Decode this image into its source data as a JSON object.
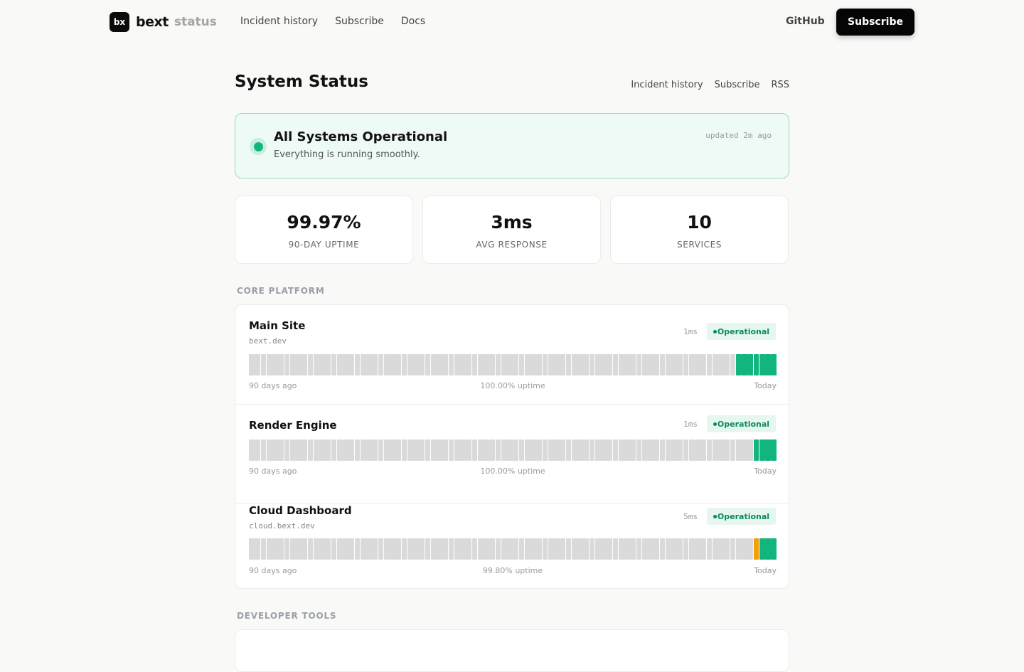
{
  "brand": {
    "mark": "bx",
    "name": "bext",
    "sub": "status"
  },
  "nav": {
    "links": [
      "Incident history",
      "Subscribe",
      "Docs"
    ],
    "github": "GitHub",
    "subscribe": "Subscribe"
  },
  "page": {
    "title": "System Status",
    "links": [
      "Incident history",
      "Subscribe",
      "RSS"
    ]
  },
  "status": {
    "title": "All Systems Operational",
    "subtitle": "Everything is running smoothly.",
    "updated": "updated 2m ago",
    "color": "#12b57e"
  },
  "stats": [
    {
      "value": "99.97%",
      "label": "90-DAY UPTIME"
    },
    {
      "value": "3ms",
      "label": "AVG RESPONSE"
    },
    {
      "value": "10",
      "label": "SERVICES"
    }
  ],
  "sections": [
    {
      "label": "CORE PLATFORM",
      "services": [
        {
          "name": "Main Site",
          "domain": "bext.dev",
          "latency": "1ms",
          "status": "Operational",
          "uptime_days": {
            "total": 90,
            "up_recent": 7,
            "warn_recent": 0
          },
          "foot": {
            "left": "90 days ago",
            "center": "100.00% uptime",
            "right": "Today"
          }
        },
        {
          "name": "Render Engine",
          "domain": "",
          "latency": "1ms",
          "status": "Operational",
          "uptime_days": {
            "total": 90,
            "up_recent": 4,
            "warn_recent": 0
          },
          "foot": {
            "left": "90 days ago",
            "center": "100.00% uptime",
            "right": "Today"
          }
        },
        {
          "name": "Cloud Dashboard",
          "domain": "cloud.bext.dev",
          "latency": "5ms",
          "status": "Operational",
          "uptime_days": {
            "total": 90,
            "up_recent": 3,
            "warn_recent": 1
          },
          "foot": {
            "left": "90 days ago",
            "center": "99.80% uptime",
            "right": "Today"
          }
        }
      ]
    },
    {
      "label": "DEVELOPER TOOLS",
      "services": []
    }
  ],
  "colors": {
    "up": "#12b57e",
    "warn": "#f59e0b",
    "no_data": "#dadada"
  }
}
